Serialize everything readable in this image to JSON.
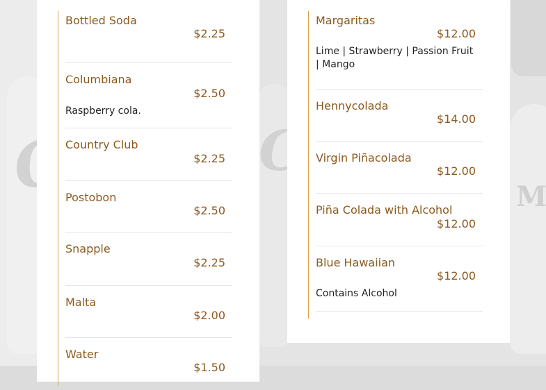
{
  "left_column": {
    "items": [
      {
        "name": "Bottled Soda",
        "price": "$2.25",
        "desc": ""
      },
      {
        "name": "Columbiana",
        "price": "$2.50",
        "desc": "Raspberry cola."
      },
      {
        "name": "Country Club",
        "price": "$2.25",
        "desc": ""
      },
      {
        "name": "Postobon",
        "price": "$2.50",
        "desc": ""
      },
      {
        "name": "Snapple",
        "price": "$2.25",
        "desc": ""
      },
      {
        "name": "Malta",
        "price": "$2.00",
        "desc": ""
      },
      {
        "name": "Water",
        "price": "$1.50",
        "desc": ""
      }
    ]
  },
  "right_column": {
    "items": [
      {
        "name": "Margaritas",
        "price": "$12.00",
        "desc": "Lime | Strawberry | Passion Fruit | Mango"
      },
      {
        "name": "Hennycolada",
        "price": "$14.00",
        "desc": ""
      },
      {
        "name": "Virgin Piñacolada",
        "price": "$12.00",
        "desc": ""
      },
      {
        "name": "Piña Colada with Alcohol",
        "price": "$12.00",
        "desc": ""
      },
      {
        "name": "Blue Hawaiian",
        "price": "$12.00",
        "desc": "Contains Alcohol"
      }
    ]
  },
  "background": {
    "labels": [
      "Co",
      "Cl",
      "MA"
    ]
  },
  "colors": {
    "accent": "#d9a24a",
    "item_text": "#8b5a1f",
    "desc_text": "#222222",
    "divider": "#e6e6e6"
  }
}
